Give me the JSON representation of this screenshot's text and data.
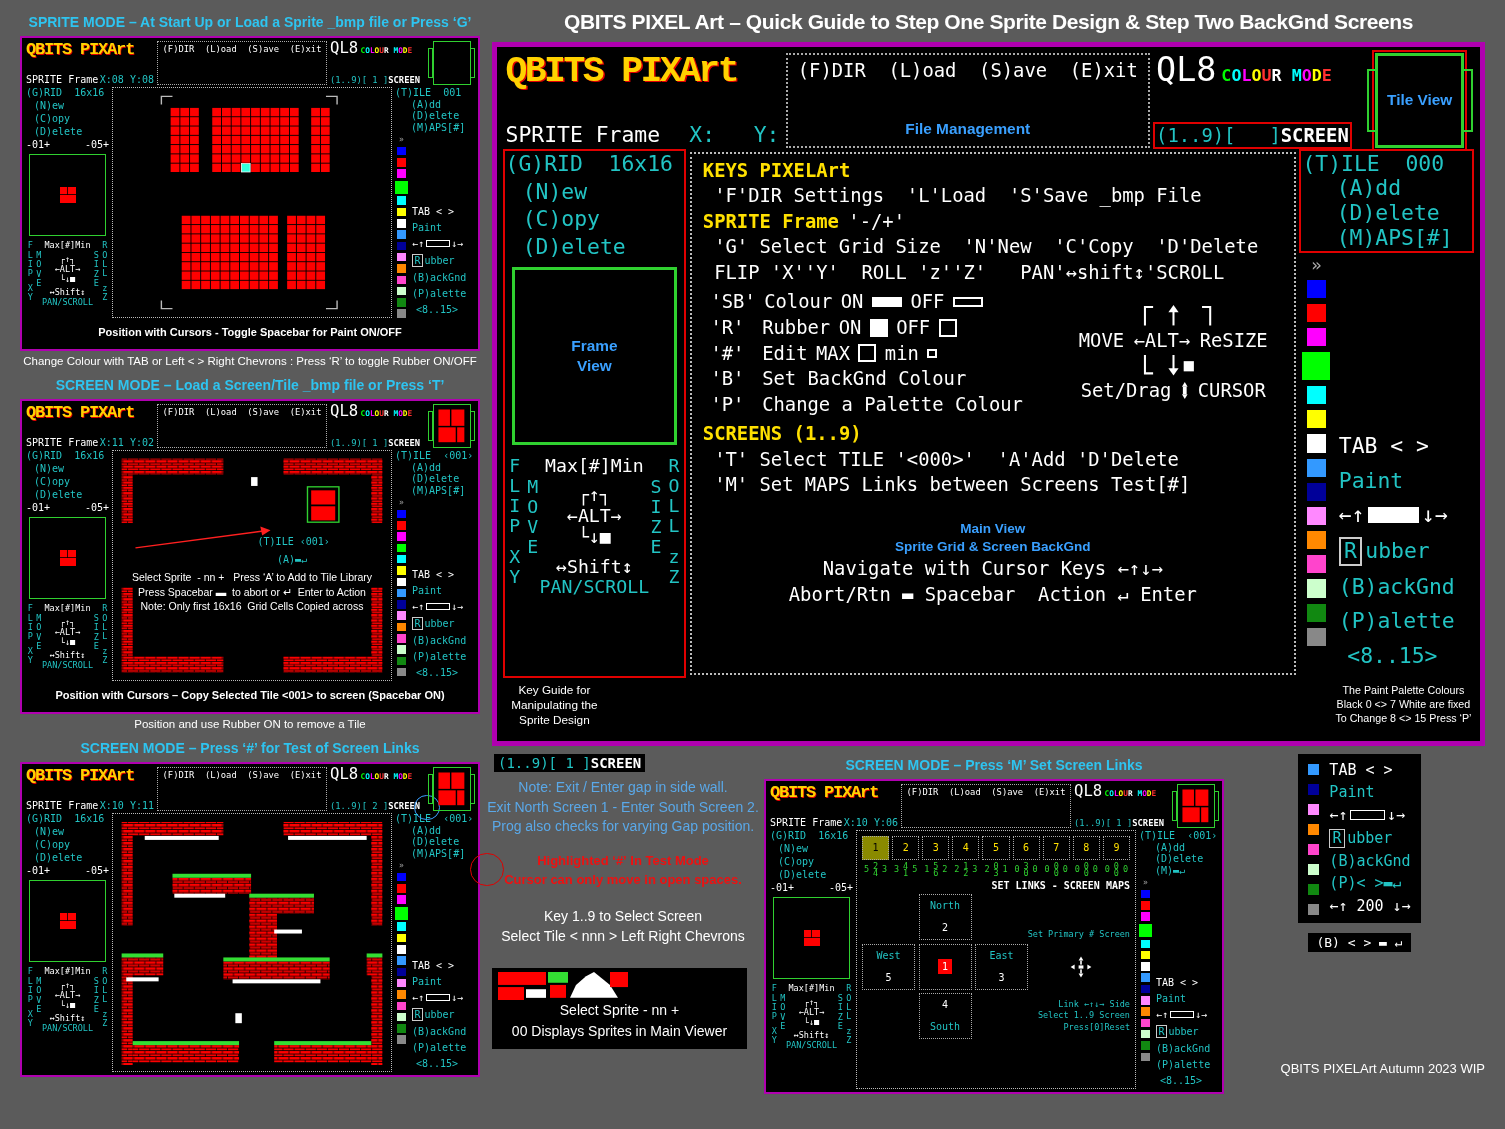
{
  "title": "QBITS PIXEL Art – Quick Guide to Step One Sprite Design & Step Two BackGnd Screens",
  "panels": [
    {
      "heading": "SPRITE MODE – At Start Up or Load a Sprite _bmp file or Press ‘G’",
      "caption": "Change Colour with TAB or Left < > Right Chevrons  : Press ‘R’ to toggle Rubber ON/OFF",
      "screen": {
        "logo": "QBITS PIXArt",
        "menu": "(F)DIR  (L)oad  (S)ave  (E)xit",
        "mode_prefix": "QL8",
        "mode": "COLOUR MODE",
        "tile_view": {
          "filled": false
        },
        "frame": "SPRITE Frame",
        "coords": "X:08 Y:08",
        "selector": {
          "text": "(1..9)[ 1 ]",
          "suffix": "SCREEN",
          "circled": false
        },
        "outline": false,
        "left": {
          "grid": "(G)RID  16x16",
          "items": [
            "(N)ew",
            "(C)opy",
            "(D)elete"
          ],
          "counters": [
            "-01+",
            "-05+"
          ],
          "frame_filled": true,
          "flip": {
            "top": "Max[#]Min",
            "flip": "FLIP",
            "xy": "XY",
            "move": "MOVE",
            "size": "SIZE",
            "roll": "ROLL",
            "zz": "zZ",
            "alt_top": "┌↑┐",
            "alt": "←ALT→",
            "alt_bottom": "└↓■",
            "shift": "↔Shift↕",
            "pan": "PAN/SCROLL"
          }
        },
        "right": {
          "tile": "(T)ILE",
          "tile_no": "001",
          "items": [
            "(A)dd",
            "(D)elete",
            "(M)APS[#]"
          ],
          "maps_circled": false,
          "marker": "»",
          "tab": "TAB < >",
          "paint": "Paint",
          "paint_left": "←↑",
          "paint_right": "↓→",
          "paint_on": false,
          "rubber_key": "R",
          "rubber": "ubber",
          "backgnd": "(B)ackGnd",
          "palette_key": "(P)alette",
          "range": "<8..15>",
          "palette": [
            {
              "color": "#0000ff",
              "selected": false
            },
            {
              "color": "#ff0000",
              "selected": false
            },
            {
              "color": "#ff00ff",
              "selected": false
            },
            {
              "color": "#00ff00",
              "selected": true
            },
            {
              "color": "#00ffff",
              "selected": false
            },
            {
              "color": "#ffff00",
              "selected": false
            },
            {
              "color": "#ffffff",
              "selected": false
            },
            {
              "color": "#3399ff",
              "selected": false
            },
            {
              "color": "#000099",
              "selected": false
            },
            {
              "color": "#ff88ff",
              "selected": false
            },
            {
              "color": "#ff8800",
              "selected": false
            },
            {
              "color": "#ff44cc",
              "selected": false
            },
            {
              "color": "#ccffcc",
              "selected": false
            },
            {
              "color": "#118811",
              "selected": false
            },
            {
              "color": "#888888",
              "selected": false
            }
          ]
        },
        "canvas": {
          "kind": "sprite-grid"
        },
        "footer": {
          "center": "Position with Cursors - Toggle Spacebar for Paint ON/OFF"
        }
      }
    },
    {
      "heading": "SCREEN MODE – Load a Screen/Tile  _bmp file or Press ‘T’",
      "caption": "Position and use Rubber ON to remove a Tile",
      "screen": {
        "logo": "QBITS PIXArt",
        "menu": "(F)DIR  (L)oad  (S)ave  (E)xit",
        "mode_prefix": "QL8",
        "mode": "COLOUR MODE",
        "tile_view": {
          "filled": true
        },
        "frame": "SPRITE Frame",
        "coords": "X:11 Y:02",
        "selector": {
          "text": "(1..9)[ 1 ]",
          "suffix": "SCREEN",
          "circled": false
        },
        "outline": false,
        "left": {
          "grid": "(G)RID  16x16",
          "items": [
            "(N)ew",
            "(C)opy",
            "(D)elete"
          ],
          "counters": [
            "-01+",
            "-05+"
          ],
          "frame_filled": true,
          "flip": {
            "top": "Max[#]Min",
            "flip": "FLIP",
            "xy": "XY",
            "move": "MOVE",
            "size": "SIZE",
            "roll": "ROLL",
            "zz": "zZ",
            "alt_top": "┌↑┐",
            "alt": "←ALT→",
            "alt_bottom": "└↓■",
            "shift": "↔Shift↕",
            "pan": "PAN/SCROLL"
          }
        },
        "right": {
          "tile": "(T)ILE",
          "tile_no": "‹001›",
          "items": [
            "(A)dd",
            "(D)elete",
            "(M)APS[#]"
          ],
          "maps_circled": false,
          "marker": "»",
          "tab": "TAB < >",
          "paint": "Paint",
          "paint_left": "←↑",
          "paint_right": "↓→",
          "paint_on": false,
          "rubber_key": "R",
          "rubber": "ubber",
          "backgnd": "(B)ackGnd",
          "palette_key": "(P)alette",
          "range": "<8..15>",
          "palette": [
            {
              "color": "#0000ff",
              "selected": false
            },
            {
              "color": "#ff0000",
              "selected": false
            },
            {
              "color": "#ff00ff",
              "selected": false
            },
            {
              "color": "#00ff00",
              "selected": false
            },
            {
              "color": "#00ffff",
              "selected": false
            },
            {
              "color": "#ffff00",
              "selected": false
            },
            {
              "color": "#ffffff",
              "selected": false
            },
            {
              "color": "#3399ff",
              "selected": false
            },
            {
              "color": "#000099",
              "selected": false
            },
            {
              "color": "#ff88ff",
              "selected": false
            },
            {
              "color": "#ff8800",
              "selected": false
            },
            {
              "color": "#ff44cc",
              "selected": false
            },
            {
              "color": "#ccffcc",
              "selected": false
            },
            {
              "color": "#118811",
              "selected": false
            },
            {
              "color": "#888888",
              "selected": false
            }
          ]
        },
        "canvas": {
          "kind": "tile-screen",
          "overlay_tile": "(T)ILE ‹001›",
          "overlay_add": "(A)▬↵",
          "notes": [
            "Select Sprite  - nn +   Press ‘A’ to Add to Tile Library",
            "Press Spacebar ▬  to abort or ↵  Enter to Action",
            "Note: Only first 16x16  Grid Cells Copied across"
          ]
        },
        "footer": {
          "center": "Position with Cursors – Copy Selected Tile <001> to screen (Spacebar ON)"
        }
      }
    },
    {
      "heading": "SCREEN MODE – Press ‘#’ for Test of Screen Links",
      "screen": {
        "logo": "QBITS PIXArt",
        "menu": "(F)DIR  (L)oad  (S)ave  (E)xit",
        "mode_prefix": "QL8",
        "mode": "COLOUR MODE",
        "tile_view": {
          "filled": true
        },
        "frame": "SPRITE Frame",
        "coords": "X:10 Y:11",
        "selector": {
          "text": "(1..9)[ 2 ]",
          "suffix": "SCREEN",
          "circled": true
        },
        "outline": false,
        "left": {
          "grid": "(G)RID  16x16",
          "items": [
            "(N)ew",
            "(C)opy",
            "(D)elete"
          ],
          "counters": [
            "-01+",
            "-05+"
          ],
          "frame_filled": true,
          "flip": {
            "top": "Max[#]Min",
            "flip": "FLIP",
            "xy": "XY",
            "move": "MOVE",
            "size": "SIZE",
            "roll": "ROLL",
            "zz": "zZ",
            "alt_top": "┌↑┐",
            "alt": "←ALT→",
            "alt_bottom": "└↓■",
            "shift": "↔Shift↕",
            "pan": "PAN/SCROLL"
          }
        },
        "right": {
          "tile": "(T)ILE",
          "tile_no": "‹001›",
          "items": [
            "(A)dd",
            "(D)elete",
            "(M)APS[#]"
          ],
          "maps_circled": true,
          "marker": "»",
          "tab": "TAB < >",
          "paint": "Paint",
          "paint_left": "←↑",
          "paint_right": "↓→",
          "paint_on": false,
          "rubber_key": "R",
          "rubber": "ubber",
          "backgnd": "(B)ackGnd",
          "palette_key": "(P)alette",
          "range": "<8..15>",
          "palette": [
            {
              "color": "#0000ff",
              "selected": false
            },
            {
              "color": "#ff0000",
              "selected": false
            },
            {
              "color": "#ff00ff",
              "selected": false
            },
            {
              "color": "#00ff00",
              "selected": true
            },
            {
              "color": "#00ffff",
              "selected": false
            },
            {
              "color": "#ffff00",
              "selected": false
            },
            {
              "color": "#ffffff",
              "selected": false
            },
            {
              "color": "#3399ff",
              "selected": false
            },
            {
              "color": "#000099",
              "selected": false
            },
            {
              "color": "#ff88ff",
              "selected": false
            },
            {
              "color": "#ff8800",
              "selected": false
            },
            {
              "color": "#ff44cc",
              "selected": false
            },
            {
              "color": "#ccffcc",
              "selected": false
            },
            {
              "color": "#118811",
              "selected": false
            },
            {
              "color": "#888888",
              "selected": false
            }
          ]
        },
        "canvas": {
          "kind": "test-screen"
        }
      }
    }
  ],
  "main": {
    "logo": "QBITS PIXArt",
    "menu": "(F)DIR  (L)oad  (S)ave  (E)xit",
    "menu_label": "File Management",
    "mode_prefix": "QL8",
    "mode": "COLOUR MODE",
    "tile_view": {
      "filled": false,
      "label": "Tile View"
    },
    "frame": "SPRITE Frame",
    "coords": "X:   Y:",
    "selector": {
      "text": "(1..9)[   ]",
      "suffix": "SCREEN",
      "circled": false
    },
    "outline": true,
    "left": {
      "grid": "(G)RID  16x16",
      "items": [
        "(N)ew",
        "(C)opy",
        "(D)elete"
      ],
      "frame_filled": false,
      "frame_label": "Frame View",
      "flip": {
        "top": "Max[#]Min",
        "flip": "FLIP",
        "xy": "XY",
        "move": "MOVE",
        "size": "SIZE",
        "roll": "ROLL",
        "zz": "zZ",
        "alt_top": "┌↑┐",
        "alt": "←ALT→",
        "alt_bottom": "└↓■",
        "shift": "↔Shift↕",
        "pan": "PAN/SCROLL"
      }
    },
    "right": {
      "tile": "(T)ILE",
      "tile_no": "000",
      "items": [
        "(A)dd",
        "(D)elete",
        "(M)APS[#]"
      ],
      "maps_circled": false,
      "marker": "»",
      "tab": "TAB < >",
      "paint": "Paint",
      "paint_left": "←↑",
      "paint_right": "↓→",
      "paint_on": true,
      "rubber_key": "R",
      "rubber": "ubber",
      "backgnd": "(B)ackGnd",
      "palette_key": "(P)alette",
      "range": "<8..15>",
      "palette": [
        {
          "color": "#0000ff",
          "selected": false
        },
        {
          "color": "#ff0000",
          "selected": false
        },
        {
          "color": "#ff00ff",
          "selected": false
        },
        {
          "color": "#00ff00",
          "selected": true
        },
        {
          "color": "#00ffff",
          "selected": false
        },
        {
          "color": "#ffff00",
          "selected": false
        },
        {
          "color": "#ffffff",
          "selected": false
        },
        {
          "color": "#3399ff",
          "selected": false
        },
        {
          "color": "#000099",
          "selected": false
        },
        {
          "color": "#ff88ff",
          "selected": false
        },
        {
          "color": "#ff8800",
          "selected": false
        },
        {
          "color": "#ff44cc",
          "selected": false
        },
        {
          "color": "#ccffcc",
          "selected": false
        },
        {
          "color": "#118811",
          "selected": false
        },
        {
          "color": "#888888",
          "selected": false
        }
      ]
    },
    "canvas": {
      "kind": "key-guide",
      "heading": "KEYS PIXELArt",
      "file_line": "'F'DIR Settings  'L'Load  'S'Save _bmp File",
      "sprite_heading": "SPRITE Frame",
      "sprite_keys": "'-/+'",
      "sprite_lines": [
        "'G' Select Grid Size  'N'New  'C'Copy  'D'Delete",
        "FLIP 'X''Y'  ROLL 'z''Z'   PAN'↔shift↕'SCROLL"
      ],
      "options": [
        {
          "key": "'SB'",
          "text": "Colour",
          "on": "ON",
          "off": "OFF",
          "kind": "bar"
        },
        {
          "key": "'R'",
          "text": "Rubber",
          "on": "ON",
          "off": "OFF",
          "kind": "square"
        },
        {
          "key": "'#'",
          "text": "Edit",
          "on": "MAX",
          "off": "min",
          "kind": "size"
        },
        {
          "key": "'B'",
          "text": "Set BackGnd Colour"
        },
        {
          "key": "'P'",
          "text": "Change a Palette Colour"
        }
      ],
      "cursor": {
        "move": "MOVE",
        "alt": "←ALT→",
        "resize": "ReSIZE",
        "drag": "Set/Drag",
        "cursor": "CURSOR"
      },
      "screens_heading": "SCREENS (1..9)",
      "screen_lines": [
        "'T' Select TILE '<000>'  'A'Add 'D'Delete",
        "'M' Set MAPS Links between Screens Test[#]"
      ],
      "labels": [
        "Main View",
        "Sprite Grid & Screen BackGnd"
      ],
      "nav_lines": [
        "Navigate with Cursor Keys ←↑↓→",
        "Abort/Rtn ▬ Spacebar  Action ↵ Enter"
      ]
    },
    "footer": {
      "left": "Key Guide for Manipulating the Sprite Design",
      "right": [
        "The Paint Palette Colours",
        "Black 0 <> 7 White are fixed",
        "To Change 8 <> 15 Press ‘P’"
      ]
    }
  },
  "notes": {
    "selector": {
      "text": "(1..9)[ 1 ]",
      "suffix": "SCREEN"
    },
    "blue": [
      "Note: Exit / Enter gap in side wall.",
      "Exit North Screen 1 - Enter South Screen 2.",
      "Prog also checks for varying Gap position."
    ],
    "red": [
      "Highlighted **‘#’** In Test Mode",
      "Cursor can only move in open spaces."
    ],
    "keys": [
      "Key 1..9 to Select Screen",
      "Select Tile < nnn > Left Right Chevrons"
    ],
    "sprite_strip": [
      "Select Sprite  - nn +",
      "00 Displays Sprites in Main Viewer"
    ]
  },
  "links_panel": {
    "heading": "SCREEN MODE – Press ‘M’ Set Screen Links",
    "screen": {
      "logo": "QBITS PIXArt",
      "menu": "(F)DIR  (L)oad  (S)ave  (E)xit",
      "mode_prefix": "QL8",
      "mode": "COLOUR MODE",
      "tile_view": {
        "filled": true
      },
      "frame": "SPRITE Frame",
      "coords": "X:10 Y:06",
      "selector": {
        "text": "(1..9)[ 1 ]",
        "suffix": "SCREEN",
        "circled": false
      },
      "outline": false,
      "left": {
        "grid": "(G)RID  16x16",
        "items": [
          "(N)ew",
          "(C)opy",
          "(D)elete"
        ],
        "counters": [
          "-01+",
          "-05+"
        ],
        "frame_filled": true,
        "flip": {
          "top": "Max[#]Min",
          "flip": "FLIP",
          "xy": "XY",
          "move": "MOVE",
          "size": "SIZE",
          "roll": "ROLL",
          "zz": "zZ",
          "alt_top": "┌↑┐",
          "alt": "←ALT→",
          "alt_bottom": "└↓■",
          "shift": "↔Shift↕",
          "pan": "PAN/SCROLL"
        }
      },
      "right": {
        "tile": "(T)ILE",
        "tile_no": "‹001›",
        "items": [
          "(A)dd",
          "(D)elete",
          "(M)▬↵"
        ],
        "maps_circled": false,
        "marker": "»",
        "tab": "TAB < >",
        "paint": "Paint",
        "paint_left": "←↑",
        "paint_right": "↓→",
        "paint_on": false,
        "rubber_key": "R",
        "rubber": "ubber",
        "backgnd": "(B)ackGnd",
        "palette_key": "(P)alette",
        "range": "<8..15>",
        "palette": [
          {
            "color": "#0000ff",
            "selected": false
          },
          {
            "color": "#ff0000",
            "selected": false
          },
          {
            "color": "#ff00ff",
            "selected": false
          },
          {
            "color": "#00ff00",
            "selected": true
          },
          {
            "color": "#00ffff",
            "selected": false
          },
          {
            "color": "#ffff00",
            "selected": false
          },
          {
            "color": "#ffffff",
            "selected": false
          },
          {
            "color": "#3399ff",
            "selected": false
          },
          {
            "color": "#000099",
            "selected": false
          },
          {
            "color": "#ff88ff",
            "selected": false
          },
          {
            "color": "#ff8800",
            "selected": false
          },
          {
            "color": "#ff44cc",
            "selected": false
          },
          {
            "color": "#ccffcc",
            "selected": false
          },
          {
            "color": "#118811",
            "selected": false
          },
          {
            "color": "#888888",
            "selected": false
          }
        ]
      },
      "canvas": {
        "kind": "links",
        "screens": [
          {
            "label": "1",
            "selected": true
          },
          {
            "label": "2",
            "selected": false
          },
          {
            "label": "3",
            "selected": false
          },
          {
            "label": "4",
            "selected": false
          },
          {
            "label": "5",
            "selected": false
          },
          {
            "label": "6",
            "selected": false
          },
          {
            "label": "7",
            "selected": false
          },
          {
            "label": "8",
            "selected": false
          },
          {
            "label": "9",
            "selected": false
          }
        ],
        "links": [
          {
            "n": "2",
            "w": "5",
            "e": "3",
            "s": "4"
          },
          {
            "n": "4",
            "w": "3",
            "e": "5",
            "s": "1"
          },
          {
            "n": "5",
            "w": "1",
            "e": "2",
            "s": "6"
          },
          {
            "n": "1",
            "w": "2",
            "e": "3",
            "s": "2"
          },
          {
            "n": "0",
            "w": "2",
            "e": "1",
            "s": "3"
          },
          {
            "n": "3",
            "w": "0",
            "e": "0",
            "s": "0"
          },
          {
            "n": "0",
            "w": "0",
            "e": "0",
            "s": "0"
          },
          {
            "n": "0",
            "w": "0",
            "e": "0",
            "s": "0"
          },
          {
            "n": "0",
            "w": "0",
            "e": "0",
            "s": "0"
          }
        ],
        "title": "SET LINKS - SCREEN MAPS",
        "sides": [
          {
            "kind": "north",
            "label": "North",
            "value": "2"
          },
          {
            "kind": "west",
            "label": "West",
            "value": "5"
          },
          {
            "kind": "east",
            "label": "East",
            "value": "3"
          },
          {
            "kind": "south",
            "label": "South",
            "value": "4"
          }
        ],
        "center": "1",
        "primary": "Set Primary # Screen",
        "hints": [
          "Link ←↑↓→ Side",
          "Select 1..9 Screen",
          "Press[0]Reset"
        ]
      }
    }
  },
  "legend": {
    "palette": [
      {
        "color": "#3399ff"
      },
      {
        "color": "#000099"
      },
      {
        "color": "#ff88ff"
      },
      {
        "color": "#ff8800"
      },
      {
        "color": "#ff44cc"
      },
      {
        "color": "#ccffcc"
      },
      {
        "color": "#118811"
      },
      {
        "color": "#888888"
      }
    ],
    "tab": "TAB < >",
    "paint": "Paint",
    "paint_left": "←↑",
    "paint_right": "↓→",
    "rubber_key": "R",
    "rubber": "ubber",
    "backgnd": "(B)ackGnd",
    "palette_line": "(P)< >▬↵",
    "count_line": "←↑ 200 ↓→",
    "extra": "(B) < > ▬ ↵"
  },
  "credit": "QBITS PIXELArt Autumn 2023 WIP"
}
